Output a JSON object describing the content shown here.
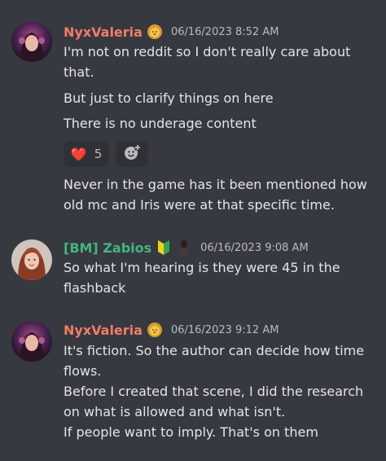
{
  "messages": [
    {
      "username": "NyxValeria",
      "username_color": "#f47b67",
      "badge_icon": "lion-face-icon",
      "timestamp": "06/16/2023 8:52 AM",
      "lines": [
        "I'm not on reddit so I don't really care about",
        "that.",
        "But just to clarify things on here",
        "There is no underage content"
      ],
      "reaction": {
        "emoji": "❤️",
        "count": "5"
      },
      "followup_lines": [
        "Never in the game has it been mentioned how",
        "old mc and Iris were at that specific time."
      ]
    },
    {
      "username": "[BM] Zabios",
      "username_color": "#43b581",
      "badge_icons": [
        "beginner-badge-icon",
        "woman-silhouette-icon"
      ],
      "timestamp": "06/16/2023 9:08 AM",
      "lines": [
        "So what I'm hearing is they were 45 in the",
        "flashback"
      ]
    },
    {
      "username": "NyxValeria",
      "username_color": "#f47b67",
      "badge_icon": "lion-face-icon",
      "timestamp": "06/16/2023 9:12 AM",
      "lines": [
        "It's fiction. So the author can decide how time",
        "flows.",
        "Before I created that scene, I did the research",
        "on what is allowed and what isn't.",
        "If people want to imply. That's on them"
      ]
    }
  ],
  "colors": {
    "background": "#36393f",
    "text": "#e3e5e8",
    "muted": "#b9bbbe",
    "reaction_bg": "#2f3136"
  }
}
